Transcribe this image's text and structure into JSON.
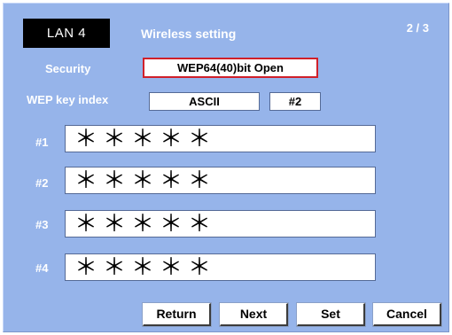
{
  "header": {
    "lan_label": "LAN 4",
    "title": "Wireless setting",
    "page": "2 / 3"
  },
  "security": {
    "label": "Security",
    "value": "WEP64(40)bit Open"
  },
  "wep": {
    "label": "WEP key index",
    "mode": "ASCII",
    "index": "#2"
  },
  "keys": [
    {
      "label": "#1",
      "value": "＊＊＊＊＊"
    },
    {
      "label": "#2",
      "value": "＊＊＊＊＊"
    },
    {
      "label": "#3",
      "value": "＊＊＊＊＊"
    },
    {
      "label": "#4",
      "value": "＊＊＊＊＊"
    }
  ],
  "buttons": {
    "return": "Return",
    "next": "Next",
    "set": "Set",
    "cancel": "Cancel"
  },
  "colors": {
    "background": "#96b4ea",
    "highlight": "#d0202a"
  }
}
